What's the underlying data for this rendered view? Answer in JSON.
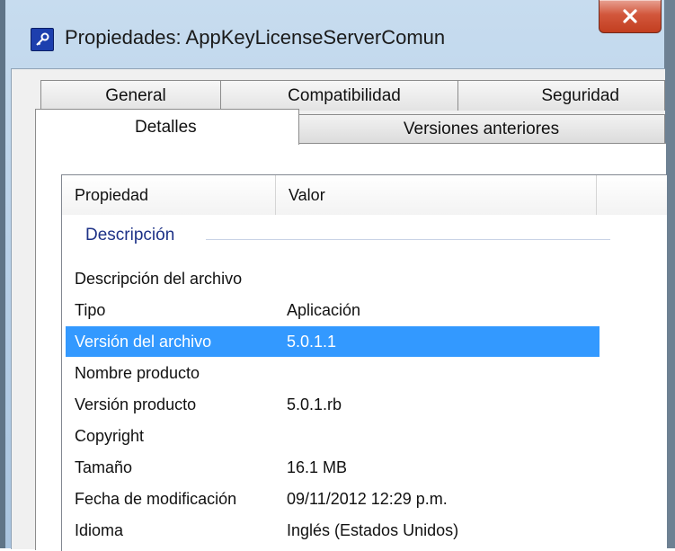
{
  "window": {
    "title": "Propiedades: AppKeyLicenseServerComun",
    "icon": "key-icon",
    "close_icon": "close-icon"
  },
  "tabs_back_row": [
    {
      "label": "General"
    },
    {
      "label": "Compatibilidad"
    },
    {
      "label": "Seguridad"
    }
  ],
  "tabs_front_row": [
    {
      "label": "Detalles",
      "selected": true
    },
    {
      "label": "Versiones anteriores",
      "selected": false
    }
  ],
  "list": {
    "columns": [
      "Propiedad",
      "Valor"
    ],
    "group": "Descripción",
    "rows": [
      {
        "name": "Descripción del archivo",
        "value": ""
      },
      {
        "name": "Tipo",
        "value": "Aplicación"
      },
      {
        "name": "Versión del archivo",
        "value": "5.0.1.1",
        "selected": true
      },
      {
        "name": "Nombre producto",
        "value": ""
      },
      {
        "name": "Versión producto",
        "value": "5.0.1.rb"
      },
      {
        "name": "Copyright",
        "value": ""
      },
      {
        "name": "Tamaño",
        "value": "16.1 MB"
      },
      {
        "name": "Fecha de modificación",
        "value": "09/11/2012 12:29 p.m."
      },
      {
        "name": "Idioma",
        "value": "Inglés (Estados Unidos)"
      }
    ]
  },
  "colors": {
    "selection": "#3399ff",
    "group_header": "#1e3287",
    "close_button": "#c23e20"
  }
}
